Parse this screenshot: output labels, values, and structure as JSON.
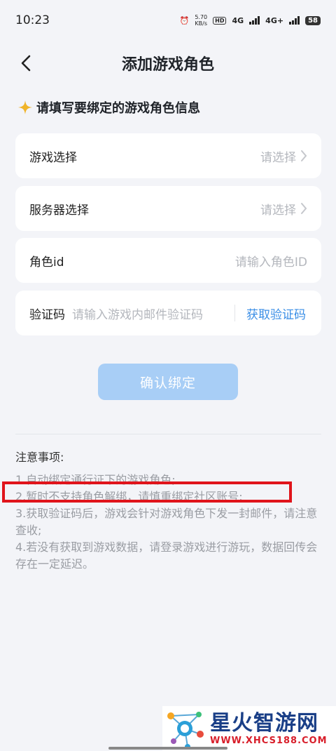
{
  "status_bar": {
    "time": "10:23",
    "net_speed_value": "5.70",
    "net_speed_unit": "KB/s",
    "hd_badge": "HD",
    "signal_1": "4G",
    "signal_2": "4G+",
    "battery": "58"
  },
  "header": {
    "title": "添加游戏角色",
    "back_icon": "chevron-left-icon"
  },
  "section_hint": {
    "icon": "sparkle-icon",
    "text": "请填写要绑定的游戏角色信息"
  },
  "form": {
    "game": {
      "label": "游戏选择",
      "placeholder": "请选择"
    },
    "server": {
      "label": "服务器选择",
      "placeholder": "请选择"
    },
    "role_id": {
      "label": "角色id",
      "placeholder": "请输入角色ID"
    },
    "code": {
      "label": "验证码",
      "placeholder": "请输入游戏内邮件验证码",
      "action": "获取验证码"
    }
  },
  "confirm_button": "确认绑定",
  "notes": {
    "title": "注意事项:",
    "items": [
      "1.自动绑定通行证下的游戏角色;",
      "2.暂时不支持角色解绑，请慎重绑定社区账号;",
      "3.获取验证码后，游戏会针对游戏角色下发一封邮件，请注意查收;",
      "4.若没有获取到游戏数据，请登录游戏进行游玩，数据回传会存在一定延迟。"
    ]
  },
  "watermark": {
    "name": "星火智游网",
    "url": "WWW.XHCS188.COM"
  },
  "colors": {
    "accent": "#3a8ee6",
    "button": "#a8cef6",
    "highlight": "#e0141b",
    "sparkle": "#f0b429"
  }
}
